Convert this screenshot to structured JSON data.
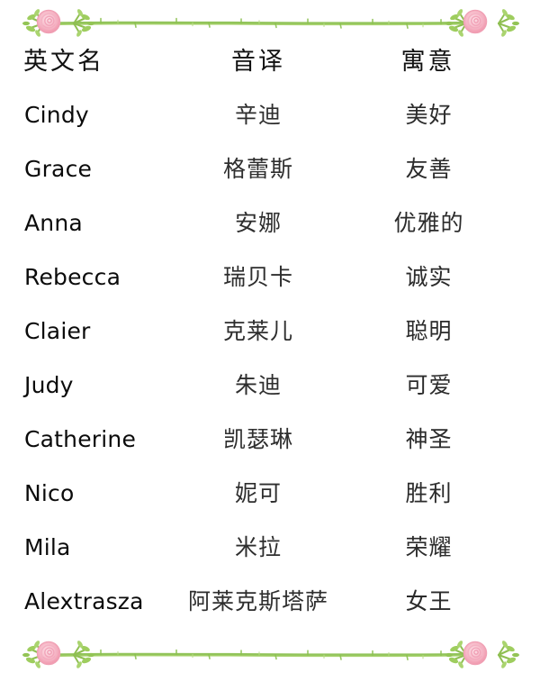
{
  "decoration": {
    "top_divider": "rose-vine-divider",
    "bottom_divider": "rose-vine-divider",
    "rose_color": "#f3a9bc",
    "rose_light": "#fbd3dc",
    "vine_color": "#8cc152",
    "leaf_color": "#9ccc5a"
  },
  "table": {
    "headers": {
      "english": "英文名",
      "transliteration": "音译",
      "meaning": "寓意"
    },
    "rows": [
      {
        "english": "Cindy",
        "transliteration": "辛迪",
        "meaning": "美好"
      },
      {
        "english": "Grace",
        "transliteration": "格蕾斯",
        "meaning": "友善"
      },
      {
        "english": "Anna",
        "transliteration": "安娜",
        "meaning": "优雅的"
      },
      {
        "english": "Rebecca",
        "transliteration": "瑞贝卡",
        "meaning": "诚实"
      },
      {
        "english": "Claier",
        "transliteration": "克莱儿",
        "meaning": "聪明"
      },
      {
        "english": "Judy",
        "transliteration": "朱迪",
        "meaning": "可爱"
      },
      {
        "english": "Catherine",
        "transliteration": "凯瑟琳",
        "meaning": "神圣"
      },
      {
        "english": "Nico",
        "transliteration": "妮可",
        "meaning": "胜利"
      },
      {
        "english": "Mila",
        "transliteration": "米拉",
        "meaning": "荣耀"
      },
      {
        "english": "Alextrasza",
        "transliteration": "阿莱克斯塔萨",
        "meaning": "女王"
      }
    ]
  }
}
